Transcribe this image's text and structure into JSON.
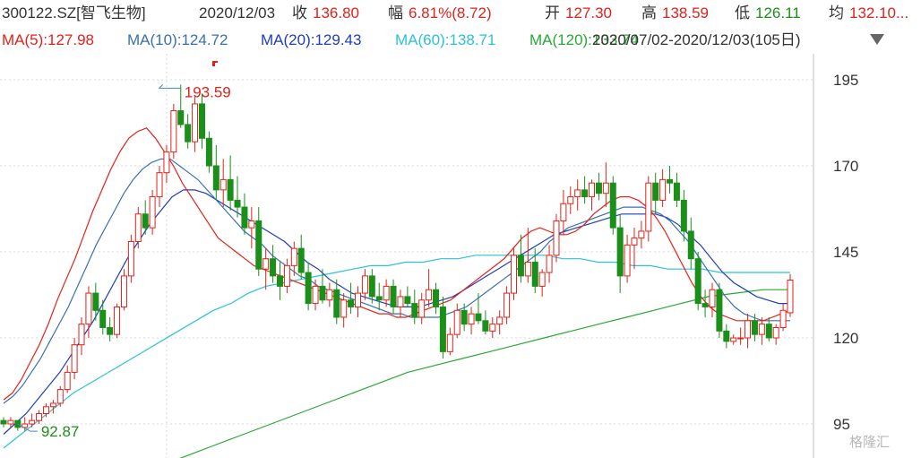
{
  "header": {
    "code": "300122.SZ[智飞生物]",
    "date": "2020/12/03",
    "close_label": "收",
    "close_value": "136.80",
    "change_label": "幅",
    "change_value": "6.81%(8.72)",
    "open_label": "开",
    "open_value": "127.30",
    "high_label": "高",
    "high_value": "138.59",
    "low_label": "低",
    "low_value": "126.11",
    "avg_label": "均",
    "avg_value": "132.10..."
  },
  "ma_legend": {
    "ma5": "MA(5):127.98",
    "ma10": "MA(10):124.72",
    "ma20": "MA(20):129.43",
    "ma60": "MA(60):138.71",
    "ma120": "MA(120):133.74",
    "range": "2020/07/02-2020/12/03(105日)"
  },
  "colors": {
    "up": "#e0221a",
    "down": "#1a8f1a",
    "ma5": "#e0221a",
    "ma10": "#3a6fb0",
    "ma20": "#1f3fb8",
    "ma60": "#2cc2d6",
    "ma120": "#2aa836"
  },
  "annotations": {
    "high": "193.59",
    "low": "92.87",
    "high_value": 193.59,
    "low_value": 92.87
  },
  "watermark": "格隆汇",
  "chart_data": {
    "type": "candlestick",
    "yticks": [
      95,
      120,
      145,
      170,
      195
    ],
    "ylim": [
      85,
      200
    ],
    "candles": [
      [
        96,
        97,
        94,
        95
      ],
      [
        95,
        97,
        94,
        96
      ],
      [
        96,
        96,
        93,
        94
      ],
      [
        94,
        97,
        93,
        95
      ],
      [
        95,
        98,
        94,
        96
      ],
      [
        96,
        99,
        95,
        98
      ],
      [
        98,
        101,
        97,
        100
      ],
      [
        100,
        102,
        98,
        101
      ],
      [
        101,
        106,
        100,
        105
      ],
      [
        105,
        112,
        104,
        110
      ],
      [
        110,
        120,
        108,
        118
      ],
      [
        118,
        126,
        115,
        124
      ],
      [
        124,
        135,
        120,
        133
      ],
      [
        133,
        136,
        125,
        128
      ],
      [
        128,
        131,
        121,
        123
      ],
      [
        123,
        126,
        119,
        121
      ],
      [
        121,
        130,
        120,
        129
      ],
      [
        129,
        140,
        128,
        138
      ],
      [
        138,
        150,
        136,
        148
      ],
      [
        148,
        158,
        146,
        156
      ],
      [
        156,
        160,
        150,
        152
      ],
      [
        152,
        163,
        150,
        161
      ],
      [
        161,
        170,
        158,
        168
      ],
      [
        168,
        176,
        165,
        174
      ],
      [
        174,
        188,
        172,
        186
      ],
      [
        186,
        193.59,
        181,
        182
      ],
      [
        182,
        185,
        175,
        177
      ],
      [
        177,
        190,
        174,
        188
      ],
      [
        188,
        191,
        175,
        178
      ],
      [
        178,
        180,
        168,
        170
      ],
      [
        170,
        176,
        160,
        163
      ],
      [
        163,
        172,
        158,
        166
      ],
      [
        166,
        173,
        157,
        160
      ],
      [
        160,
        167,
        155,
        158
      ],
      [
        158,
        162,
        150,
        152
      ],
      [
        152,
        158,
        146,
        154
      ],
      [
        154,
        158,
        138,
        140
      ],
      [
        140,
        146,
        134,
        143
      ],
      [
        143,
        147,
        136,
        138
      ],
      [
        138,
        142,
        131,
        135
      ],
      [
        135,
        143,
        133,
        141
      ],
      [
        141,
        148,
        138,
        146
      ],
      [
        146,
        150,
        137,
        139
      ],
      [
        139,
        142,
        128,
        130
      ],
      [
        130,
        137,
        128,
        135
      ],
      [
        135,
        140,
        130,
        131
      ],
      [
        131,
        136,
        129,
        134
      ],
      [
        134,
        137,
        124,
        126
      ],
      [
        126,
        133,
        123,
        131
      ],
      [
        131,
        136,
        127,
        129
      ],
      [
        129,
        135,
        126,
        133
      ],
      [
        133,
        140,
        131,
        138
      ],
      [
        138,
        140,
        130,
        132
      ],
      [
        132,
        136,
        128,
        131
      ],
      [
        131,
        137,
        129,
        135
      ],
      [
        135,
        137,
        127,
        129
      ],
      [
        129,
        134,
        126,
        132
      ],
      [
        132,
        135,
        129,
        130
      ],
      [
        130,
        134,
        124,
        126
      ],
      [
        126,
        133,
        124,
        131
      ],
      [
        131,
        140,
        129,
        134
      ],
      [
        134,
        136,
        127,
        129
      ],
      [
        129,
        132,
        114,
        116
      ],
      [
        116,
        123,
        115,
        121
      ],
      [
        121,
        130,
        120,
        128
      ],
      [
        128,
        130,
        122,
        124
      ],
      [
        124,
        129,
        121,
        127
      ],
      [
        127,
        133,
        124,
        125
      ],
      [
        125,
        128,
        121,
        122
      ],
      [
        122,
        126,
        120,
        124
      ],
      [
        124,
        128,
        121,
        126
      ],
      [
        126,
        135,
        124,
        133
      ],
      [
        133,
        146,
        131,
        144
      ],
      [
        144,
        150,
        136,
        138
      ],
      [
        138,
        152,
        136,
        142
      ],
      [
        142,
        146,
        133,
        135
      ],
      [
        135,
        140,
        132,
        139
      ],
      [
        139,
        147,
        136,
        144
      ],
      [
        144,
        156,
        142,
        154
      ],
      [
        154,
        163,
        150,
        159
      ],
      [
        159,
        164,
        156,
        161
      ],
      [
        161,
        166,
        157,
        163
      ],
      [
        163,
        167,
        159,
        161
      ],
      [
        161,
        166,
        157,
        165
      ],
      [
        165,
        168,
        160,
        162
      ],
      [
        162,
        171,
        158,
        165
      ],
      [
        165,
        167,
        150,
        152
      ],
      [
        152,
        156,
        133,
        138
      ],
      [
        138,
        150,
        136,
        147
      ],
      [
        147,
        152,
        140,
        149
      ],
      [
        149,
        154,
        146,
        151
      ],
      [
        151,
        167,
        148,
        165
      ],
      [
        165,
        168,
        156,
        160
      ],
      [
        160,
        169,
        158,
        166
      ],
      [
        166,
        170,
        162,
        165
      ],
      [
        165,
        168,
        158,
        160
      ],
      [
        160,
        163,
        148,
        151
      ],
      [
        151,
        155,
        140,
        143
      ],
      [
        143,
        145,
        128,
        130
      ],
      [
        130,
        134,
        126,
        129
      ],
      [
        129,
        136,
        126,
        134
      ],
      [
        134,
        136,
        120,
        122
      ],
      [
        122,
        124,
        117,
        119
      ],
      [
        119,
        121,
        118,
        120
      ],
      [
        120,
        123,
        118,
        120
      ],
      [
        120,
        127,
        117,
        125
      ],
      [
        125,
        127,
        119,
        121
      ],
      [
        121,
        126,
        118,
        124
      ],
      [
        124,
        126,
        119,
        120
      ],
      [
        120,
        124,
        118,
        123
      ],
      [
        123,
        130,
        122,
        128
      ],
      [
        127.3,
        138.59,
        126.11,
        136.8
      ]
    ],
    "ma5": [
      102,
      104,
      108,
      113,
      118,
      124,
      131,
      137,
      143,
      150,
      157,
      163,
      169,
      174,
      178,
      180,
      181,
      178,
      174,
      170,
      165,
      161,
      157,
      153,
      149,
      147,
      145,
      143,
      141,
      140,
      139,
      138,
      137,
      136,
      135,
      134,
      133,
      132,
      131,
      130,
      129,
      128,
      127,
      127,
      126,
      126,
      127,
      128,
      129,
      130,
      131,
      133,
      135,
      137,
      139,
      141,
      143,
      146,
      149,
      151,
      152,
      151,
      150,
      150,
      151,
      153,
      156,
      158,
      160,
      161,
      161,
      160,
      158,
      155,
      151,
      146,
      141,
      136,
      132,
      129,
      127,
      126,
      125,
      125,
      125,
      125,
      126,
      127,
      128
    ],
    "ma10": [
      101,
      103,
      106,
      110,
      114,
      119,
      124,
      129,
      135,
      141,
      147,
      152,
      157,
      162,
      166,
      169,
      171,
      172,
      172,
      170,
      168,
      166,
      163,
      160,
      157,
      154,
      151,
      149,
      147,
      144,
      142,
      140,
      138,
      137,
      135,
      134,
      133,
      132,
      131,
      130,
      129,
      128,
      127,
      127,
      126,
      126,
      126,
      126,
      127,
      128,
      129,
      131,
      133,
      135,
      137,
      139,
      141,
      143,
      145,
      148,
      150,
      152,
      153,
      154,
      155,
      156,
      157,
      158,
      158,
      158,
      157,
      156,
      154,
      151,
      148,
      144,
      140,
      136,
      132,
      129,
      127,
      126,
      125,
      125,
      125,
      125
    ],
    "ma20": [
      92,
      95,
      98,
      102,
      106,
      110,
      115,
      120,
      125,
      131,
      137,
      143,
      148,
      153,
      157,
      161,
      163,
      163,
      162,
      160,
      158,
      156,
      154,
      152,
      150,
      148,
      145,
      142,
      140,
      137,
      135,
      133,
      132,
      131,
      130,
      129,
      129,
      129,
      130,
      131,
      132,
      134,
      136,
      138,
      140,
      142,
      144,
      146,
      148,
      150,
      151,
      152,
      153,
      154,
      155,
      156,
      156,
      156,
      156,
      155,
      153,
      150,
      147,
      143,
      139,
      136,
      134,
      132,
      131,
      130,
      130
    ],
    "ma60": [
      88,
      92,
      96,
      100,
      104,
      107,
      110,
      113,
      116,
      119,
      122,
      125,
      128,
      130,
      133,
      135,
      136,
      137,
      138,
      139,
      140,
      141,
      141,
      142,
      142,
      143,
      143,
      144,
      144,
      144,
      144,
      144,
      143,
      143,
      142,
      142,
      141,
      141,
      140,
      140,
      140,
      139,
      139,
      139,
      139,
      139
    ],
    "ma120": [
      80,
      83,
      86,
      89,
      92,
      95,
      98,
      101,
      104,
      107,
      110,
      112,
      114,
      116,
      118,
      120,
      122,
      124,
      126,
      128,
      130,
      132,
      133,
      134,
      134
    ]
  }
}
